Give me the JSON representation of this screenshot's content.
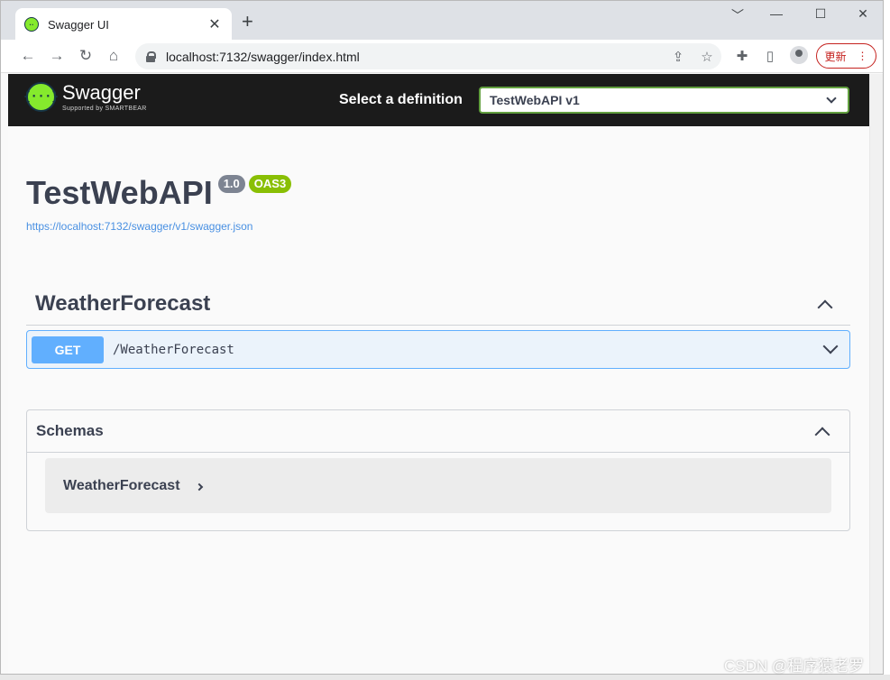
{
  "browser": {
    "tab_title": "Swagger UI",
    "tab_close": "✕",
    "new_tab": "+",
    "url": "localhost:7132/swagger/index.html",
    "update_label": "更新",
    "window_controls": [
      "﹀",
      "—",
      "☐",
      "✕"
    ]
  },
  "topbar": {
    "logo_name": "Swagger",
    "logo_sub": "Supported by SMARTBEAR",
    "logo_glyph": "{···}",
    "definition_label": "Select a definition",
    "definition_value": "TestWebAPI v1"
  },
  "info": {
    "title": "TestWebAPI",
    "version": "1.0",
    "oas": "OAS3",
    "spec_url": "https://localhost:7132/swagger/v1/swagger.json"
  },
  "tag": {
    "name": "WeatherForecast",
    "operations": [
      {
        "method": "GET",
        "path": "/WeatherForecast"
      }
    ]
  },
  "schemas": {
    "title": "Schemas",
    "models": [
      "WeatherForecast"
    ]
  },
  "watermark": "CSDN @程序猿老罗",
  "colors": {
    "get_method": "#61affe",
    "get_bg": "#ebf3fb",
    "topbar": "#1b1b1b",
    "oas_badge": "#89bf04",
    "version_badge": "#7d8492",
    "link": "#4990e2",
    "update_red": "#c5221f"
  },
  "icons": [
    "swagger-favicon-icon",
    "back-icon",
    "forward-icon",
    "reload-icon",
    "home-icon",
    "lock-icon",
    "share-icon",
    "star-icon",
    "extensions-icon",
    "side-panel-icon",
    "profile-icon",
    "menu-icon",
    "chevron-down-icon",
    "chevron-up-icon",
    "chevron-right-icon"
  ]
}
